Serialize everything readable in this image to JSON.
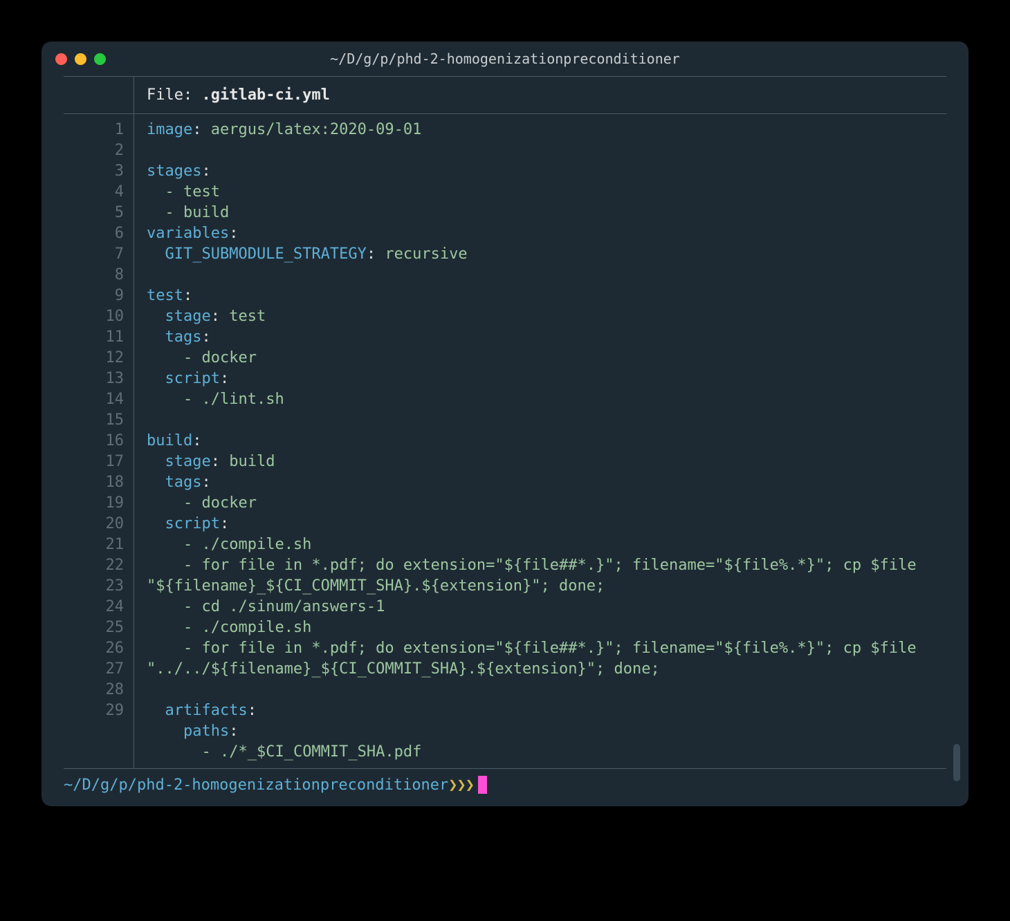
{
  "window": {
    "title": "~/D/g/p/phd-2-homogenizationpreconditioner"
  },
  "file_header": {
    "label_prefix": "File: ",
    "filename": ".gitlab-ci.yml"
  },
  "code": {
    "lines": [
      {
        "n": "1",
        "tokens": [
          [
            "key",
            "image"
          ],
          [
            "colon",
            ": "
          ],
          [
            "val",
            "aergus/latex:2020-09-01"
          ]
        ]
      },
      {
        "n": "2",
        "tokens": []
      },
      {
        "n": "3",
        "tokens": [
          [
            "key",
            "stages"
          ],
          [
            "colon",
            ":"
          ]
        ]
      },
      {
        "n": "4",
        "tokens": [
          [
            "plain",
            "  "
          ],
          [
            "dash",
            "- "
          ],
          [
            "val",
            "test"
          ]
        ]
      },
      {
        "n": "5",
        "tokens": [
          [
            "plain",
            "  "
          ],
          [
            "dash",
            "- "
          ],
          [
            "val",
            "build"
          ]
        ]
      },
      {
        "n": "6",
        "tokens": [
          [
            "key",
            "variables"
          ],
          [
            "colon",
            ":"
          ]
        ]
      },
      {
        "n": "7",
        "tokens": [
          [
            "plain",
            "  "
          ],
          [
            "key",
            "GIT_SUBMODULE_STRATEGY"
          ],
          [
            "colon",
            ": "
          ],
          [
            "val",
            "recursive"
          ]
        ]
      },
      {
        "n": "8",
        "tokens": []
      },
      {
        "n": "9",
        "tokens": [
          [
            "key",
            "test"
          ],
          [
            "colon",
            ":"
          ]
        ]
      },
      {
        "n": "10",
        "tokens": [
          [
            "plain",
            "  "
          ],
          [
            "key",
            "stage"
          ],
          [
            "colon",
            ": "
          ],
          [
            "val",
            "test"
          ]
        ]
      },
      {
        "n": "11",
        "tokens": [
          [
            "plain",
            "  "
          ],
          [
            "key",
            "tags"
          ],
          [
            "colon",
            ":"
          ]
        ]
      },
      {
        "n": "12",
        "tokens": [
          [
            "plain",
            "    "
          ],
          [
            "dash",
            "- "
          ],
          [
            "val",
            "docker"
          ]
        ]
      },
      {
        "n": "13",
        "tokens": [
          [
            "plain",
            "  "
          ],
          [
            "key",
            "script"
          ],
          [
            "colon",
            ":"
          ]
        ]
      },
      {
        "n": "14",
        "tokens": [
          [
            "plain",
            "    "
          ],
          [
            "dash",
            "- "
          ],
          [
            "val",
            "./lint.sh"
          ]
        ]
      },
      {
        "n": "15",
        "tokens": []
      },
      {
        "n": "16",
        "tokens": [
          [
            "key",
            "build"
          ],
          [
            "colon",
            ":"
          ]
        ]
      },
      {
        "n": "17",
        "tokens": [
          [
            "plain",
            "  "
          ],
          [
            "key",
            "stage"
          ],
          [
            "colon",
            ": "
          ],
          [
            "val",
            "build"
          ]
        ]
      },
      {
        "n": "18",
        "tokens": [
          [
            "plain",
            "  "
          ],
          [
            "key",
            "tags"
          ],
          [
            "colon",
            ":"
          ]
        ]
      },
      {
        "n": "19",
        "tokens": [
          [
            "plain",
            "    "
          ],
          [
            "dash",
            "- "
          ],
          [
            "val",
            "docker"
          ]
        ]
      },
      {
        "n": "20",
        "tokens": [
          [
            "plain",
            "  "
          ],
          [
            "key",
            "script"
          ],
          [
            "colon",
            ":"
          ]
        ]
      },
      {
        "n": "21",
        "tokens": [
          [
            "plain",
            "    "
          ],
          [
            "dash",
            "- "
          ],
          [
            "val",
            "./compile.sh"
          ]
        ]
      },
      {
        "n": "22",
        "tokens": [
          [
            "plain",
            "    "
          ],
          [
            "dash",
            "- "
          ],
          [
            "val",
            "for file in *.pdf; do extension=\"${file##*.}\"; filename=\"${file%.*}\"; cp $file \"${filename}_${CI_COMMIT_SHA}.${extension}\"; done;"
          ]
        ]
      },
      {
        "n": "23",
        "tokens": [
          [
            "plain",
            "    "
          ],
          [
            "dash",
            "- "
          ],
          [
            "val",
            "cd ./sinum/answers-1"
          ]
        ]
      },
      {
        "n": "24",
        "tokens": [
          [
            "plain",
            "    "
          ],
          [
            "dash",
            "- "
          ],
          [
            "val",
            "./compile.sh"
          ]
        ]
      },
      {
        "n": "25",
        "tokens": [
          [
            "plain",
            "    "
          ],
          [
            "dash",
            "- "
          ],
          [
            "val",
            "for file in *.pdf; do extension=\"${file##*.}\"; filename=\"${file%.*}\"; cp $file \"../../${filename}_${CI_COMMIT_SHA}.${extension}\"; done;"
          ]
        ]
      },
      {
        "n": "26",
        "tokens": []
      },
      {
        "n": "27",
        "tokens": [
          [
            "plain",
            "  "
          ],
          [
            "key",
            "artifacts"
          ],
          [
            "colon",
            ":"
          ]
        ]
      },
      {
        "n": "28",
        "tokens": [
          [
            "plain",
            "    "
          ],
          [
            "key",
            "paths"
          ],
          [
            "colon",
            ":"
          ]
        ]
      },
      {
        "n": "29",
        "tokens": [
          [
            "plain",
            "      "
          ],
          [
            "dash",
            "- "
          ],
          [
            "val",
            "./*_$CI_COMMIT_SHA.pdf"
          ]
        ]
      }
    ]
  },
  "prompt": {
    "path": "~/D/g/p/phd-2-homogenizationpreconditioner",
    "arrows": " ❯❯❯ "
  }
}
